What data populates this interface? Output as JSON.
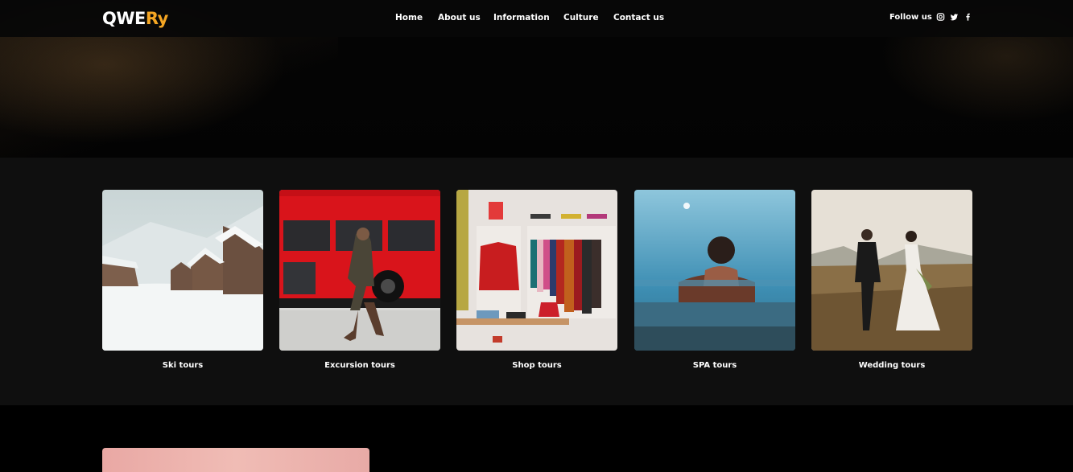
{
  "header": {
    "logo_main": "QWE",
    "logo_accent": "Ry",
    "nav": [
      "Home",
      "About us",
      "Information",
      "Culture",
      "Contact us"
    ],
    "follow_label": "Follow us",
    "social_icons": [
      "instagram-icon",
      "twitter-icon",
      "facebook-icon"
    ]
  },
  "tours": [
    {
      "label": "Ski tours",
      "image": "snowy-cabins"
    },
    {
      "label": "Excursion tours",
      "image": "red-bus-walker"
    },
    {
      "label": "Shop tours",
      "image": "clothing-store"
    },
    {
      "label": "SPA tours",
      "image": "infinity-pool"
    },
    {
      "label": "Wedding tours",
      "image": "couple-field"
    }
  ],
  "colors": {
    "accent": "#f5a623",
    "band": "#0f0f0f",
    "header": "#080808"
  }
}
